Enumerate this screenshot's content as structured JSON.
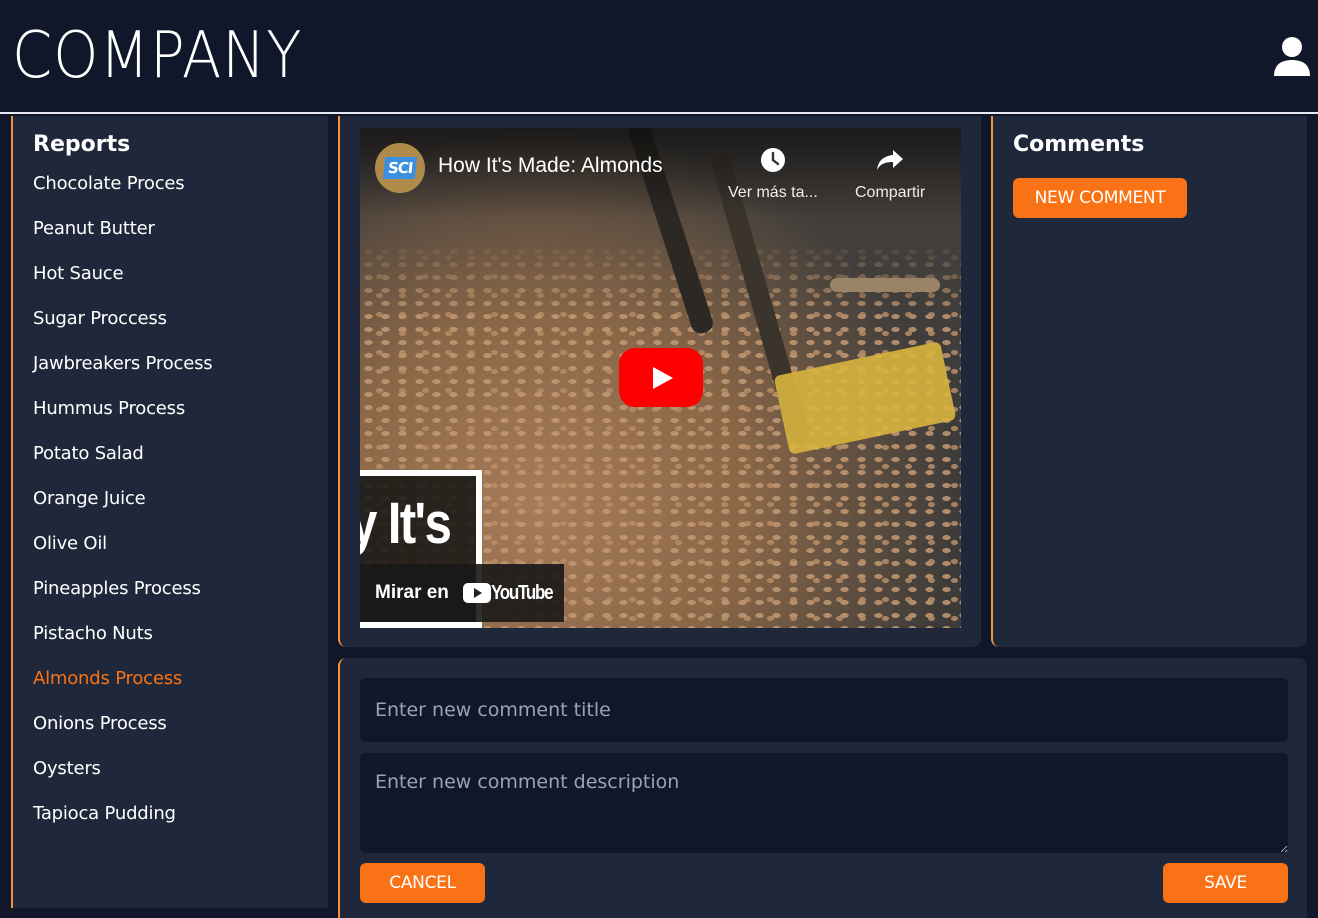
{
  "header": {
    "logo": "COMPANY",
    "user_icon": "user-icon"
  },
  "sidebar": {
    "title": "Reports",
    "items": [
      {
        "label": "Chocolate Proces"
      },
      {
        "label": "Peanut Butter"
      },
      {
        "label": "Hot Sauce"
      },
      {
        "label": "Sugar Proccess"
      },
      {
        "label": "Jawbreakers Process"
      },
      {
        "label": "Hummus Process"
      },
      {
        "label": "Potato Salad"
      },
      {
        "label": "Orange Juice"
      },
      {
        "label": "Olive Oil"
      },
      {
        "label": "Pineapples Process"
      },
      {
        "label": "Pistacho Nuts"
      },
      {
        "label": "Almonds Process",
        "active": true
      },
      {
        "label": "Onions Process"
      },
      {
        "label": "Oysters"
      },
      {
        "label": "Tapioca Pudding"
      }
    ]
  },
  "video": {
    "channel_badge": "SCI",
    "title": "How It's Made: Almonds",
    "watch_later_label": "Ver más ta...",
    "share_label": "Compartir",
    "overlay_text": "y It's",
    "watch_on_label": "Mirar en",
    "youtube_wordmark": "YouTube"
  },
  "comments": {
    "title": "Comments",
    "new_comment_label": "NEW COMMENT"
  },
  "form": {
    "title_value": "",
    "title_placeholder": "Enter new comment title",
    "description_value": "",
    "description_placeholder": "Enter new comment description",
    "cancel_label": "CANCEL",
    "save_label": "SAVE"
  },
  "colors": {
    "accent": "#f97316",
    "border_accent": "#f7923a",
    "background": "#10172a",
    "panel": "#1f283a",
    "youtube_red": "#ff0000"
  }
}
